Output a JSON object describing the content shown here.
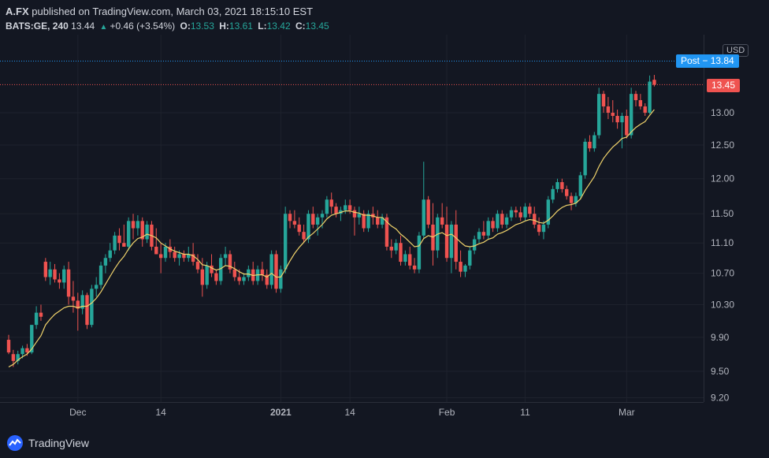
{
  "header": {
    "author": "A.FX",
    "published_text": "published on TradingView.com, March 03, 2021 18:15:10 EST"
  },
  "legend": {
    "symbol": "BATS:GE, 240",
    "last": "13.44",
    "change": "+0.46 (+3.54%)",
    "o_label": "O:",
    "o": "13.53",
    "h_label": "H:",
    "h": "13.61",
    "l_label": "L:",
    "l": "13.42",
    "c_label": "C:",
    "c": "13.45"
  },
  "price_axis": {
    "currency": "USD"
  },
  "tags": {
    "post": "Post − 13.84",
    "last": "13.45"
  },
  "footer": {
    "brand": "TradingView"
  },
  "colors": {
    "up": "#26a69a",
    "down": "#ef5350",
    "ma": "#f0d36b",
    "post_line": "#2196f3",
    "last_line": "#ef5350",
    "background": "#131722"
  },
  "chart_data": {
    "type": "candlestick",
    "symbol": "BATS:GE",
    "interval": "240",
    "y_axis": {
      "scale": "log",
      "ticks": [
        9.2,
        9.5,
        9.9,
        10.3,
        10.7,
        11.1,
        11.5,
        12.0,
        12.5,
        13.0
      ],
      "tick_labels": [
        "9.20",
        "9.50",
        "9.90",
        "10.30",
        "10.70",
        "11.10",
        "11.50",
        "12.00",
        "12.50",
        "13.00"
      ]
    },
    "x_axis": {
      "labels": [
        "Dec",
        "14",
        "2021",
        "14",
        "Feb",
        "11",
        "Mar"
      ],
      "label_candle_index": [
        15,
        33,
        59,
        74,
        95,
        112,
        134
      ]
    },
    "horizontal_lines": [
      {
        "name": "Post",
        "value": 13.84
      },
      {
        "name": "Last",
        "value": 13.45
      }
    ],
    "candles_ohlc": [
      [
        9.87,
        9.93,
        9.7,
        9.72
      ],
      [
        9.7,
        9.75,
        9.55,
        9.62
      ],
      [
        9.62,
        9.74,
        9.58,
        9.7
      ],
      [
        9.7,
        9.8,
        9.65,
        9.77
      ],
      [
        9.77,
        9.82,
        9.68,
        9.72
      ],
      [
        9.72,
        10.05,
        9.7,
        10.05
      ],
      [
        10.05,
        10.28,
        10.0,
        10.2
      ],
      [
        10.2,
        10.3,
        10.1,
        10.15
      ],
      [
        10.85,
        10.9,
        10.6,
        10.65
      ],
      [
        10.65,
        10.85,
        10.55,
        10.75
      ],
      [
        10.75,
        10.82,
        10.58,
        10.62
      ],
      [
        10.62,
        10.7,
        10.5,
        10.58
      ],
      [
        10.58,
        10.8,
        10.5,
        10.75
      ],
      [
        10.75,
        10.85,
        10.3,
        10.4
      ],
      [
        10.4,
        10.6,
        10.2,
        10.35
      ],
      [
        10.35,
        10.45,
        9.98,
        10.25
      ],
      [
        10.25,
        10.48,
        10.18,
        10.42
      ],
      [
        10.42,
        10.45,
        10.0,
        10.05
      ],
      [
        10.05,
        10.55,
        10.02,
        10.5
      ],
      [
        10.5,
        10.65,
        10.4,
        10.55
      ],
      [
        10.55,
        10.85,
        10.5,
        10.8
      ],
      [
        10.8,
        10.95,
        10.7,
        10.9
      ],
      [
        10.9,
        11.1,
        10.85,
        11.0
      ],
      [
        11.0,
        11.25,
        10.95,
        11.2
      ],
      [
        11.2,
        11.3,
        11.0,
        11.1
      ],
      [
        11.1,
        11.35,
        11.05,
        11.05
      ],
      [
        11.05,
        11.45,
        11.0,
        11.4
      ],
      [
        11.4,
        11.5,
        11.15,
        11.3
      ],
      [
        11.3,
        11.48,
        11.2,
        11.4
      ],
      [
        11.4,
        11.45,
        11.05,
        11.15
      ],
      [
        11.15,
        11.4,
        11.1,
        11.35
      ],
      [
        11.35,
        11.4,
        11.0,
        11.05
      ],
      [
        11.05,
        11.3,
        10.95,
        10.95
      ],
      [
        10.95,
        11.1,
        10.7,
        10.9
      ],
      [
        10.9,
        11.1,
        10.85,
        11.05
      ],
      [
        11.05,
        11.15,
        10.9,
        10.98
      ],
      [
        10.98,
        11.05,
        10.85,
        10.9
      ],
      [
        10.9,
        11.0,
        10.8,
        10.95
      ],
      [
        10.95,
        11.0,
        10.85,
        10.9
      ],
      [
        10.9,
        11.05,
        10.85,
        10.95
      ],
      [
        10.95,
        11.1,
        10.8,
        10.85
      ],
      [
        10.85,
        10.95,
        10.7,
        10.75
      ],
      [
        10.75,
        10.9,
        10.4,
        10.55
      ],
      [
        10.55,
        10.85,
        10.5,
        10.8
      ],
      [
        10.8,
        10.95,
        10.65,
        10.7
      ],
      [
        10.7,
        10.75,
        10.55,
        10.6
      ],
      [
        10.6,
        10.95,
        10.55,
        10.9
      ],
      [
        10.9,
        11.05,
        10.8,
        10.95
      ],
      [
        10.95,
        11.0,
        10.7,
        10.75
      ],
      [
        10.75,
        10.85,
        10.6,
        10.65
      ],
      [
        10.65,
        10.75,
        10.55,
        10.6
      ],
      [
        10.6,
        10.7,
        10.55,
        10.65
      ],
      [
        10.65,
        10.8,
        10.6,
        10.75
      ],
      [
        10.75,
        10.85,
        10.55,
        10.6
      ],
      [
        10.6,
        10.8,
        10.55,
        10.75
      ],
      [
        10.75,
        10.85,
        10.6,
        10.68
      ],
      [
        10.68,
        10.75,
        10.5,
        10.55
      ],
      [
        10.55,
        11.0,
        10.5,
        10.95
      ],
      [
        10.95,
        11.0,
        10.45,
        10.5
      ],
      [
        10.5,
        10.8,
        10.45,
        10.75
      ],
      [
        10.75,
        11.6,
        10.7,
        11.5
      ],
      [
        11.5,
        11.55,
        11.3,
        11.4
      ],
      [
        11.4,
        11.55,
        11.3,
        11.35
      ],
      [
        11.35,
        11.45,
        11.2,
        11.25
      ],
      [
        11.25,
        11.35,
        11.1,
        11.15
      ],
      [
        11.15,
        11.55,
        11.1,
        11.5
      ],
      [
        11.5,
        11.6,
        11.3,
        11.35
      ],
      [
        11.35,
        11.5,
        11.2,
        11.45
      ],
      [
        11.45,
        11.55,
        11.3,
        11.5
      ],
      [
        11.5,
        11.75,
        11.45,
        11.7
      ],
      [
        11.7,
        11.8,
        11.5,
        11.6
      ],
      [
        11.6,
        11.65,
        11.45,
        11.5
      ],
      [
        11.5,
        11.6,
        11.4,
        11.55
      ],
      [
        11.55,
        11.7,
        11.5,
        11.62
      ],
      [
        11.62,
        11.7,
        11.5,
        11.55
      ],
      [
        11.55,
        11.6,
        11.2,
        11.45
      ],
      [
        11.45,
        11.6,
        11.35,
        11.5
      ],
      [
        11.5,
        11.55,
        11.25,
        11.3
      ],
      [
        11.3,
        11.55,
        11.25,
        11.5
      ],
      [
        11.5,
        11.6,
        11.35,
        11.45
      ],
      [
        11.45,
        11.55,
        11.3,
        11.35
      ],
      [
        11.35,
        11.5,
        11.3,
        11.45
      ],
      [
        11.45,
        11.5,
        11.0,
        11.05
      ],
      [
        11.05,
        11.15,
        10.9,
        11.0
      ],
      [
        11.0,
        11.15,
        10.95,
        11.1
      ],
      [
        11.1,
        11.2,
        10.8,
        10.85
      ],
      [
        10.85,
        11.0,
        10.8,
        10.95
      ],
      [
        10.95,
        11.05,
        10.75,
        10.8
      ],
      [
        10.8,
        10.9,
        10.7,
        10.75
      ],
      [
        10.75,
        11.25,
        10.7,
        11.2
      ],
      [
        11.2,
        12.25,
        11.15,
        11.7
      ],
      [
        11.7,
        11.75,
        11.3,
        11.35
      ],
      [
        11.35,
        11.65,
        10.8,
        11.0
      ],
      [
        11.0,
        11.5,
        10.9,
        11.45
      ],
      [
        11.45,
        11.65,
        11.3,
        11.35
      ],
      [
        11.35,
        11.6,
        10.85,
        10.9
      ],
      [
        10.9,
        11.4,
        10.7,
        11.35
      ],
      [
        11.35,
        11.55,
        10.75,
        10.85
      ],
      [
        10.85,
        11.0,
        10.65,
        10.72
      ],
      [
        10.72,
        10.82,
        10.65,
        10.8
      ],
      [
        10.8,
        11.05,
        10.75,
        11.0
      ],
      [
        11.0,
        11.2,
        10.95,
        11.15
      ],
      [
        11.15,
        11.3,
        11.1,
        11.25
      ],
      [
        11.25,
        11.4,
        11.15,
        11.2
      ],
      [
        11.2,
        11.45,
        11.15,
        11.4
      ],
      [
        11.4,
        11.45,
        11.25,
        11.3
      ],
      [
        11.3,
        11.55,
        11.25,
        11.5
      ],
      [
        11.5,
        11.55,
        11.3,
        11.35
      ],
      [
        11.35,
        11.5,
        11.3,
        11.45
      ],
      [
        11.45,
        11.6,
        11.4,
        11.55
      ],
      [
        11.55,
        11.6,
        11.45,
        11.52
      ],
      [
        11.52,
        11.6,
        11.4,
        11.45
      ],
      [
        11.45,
        11.65,
        11.4,
        11.6
      ],
      [
        11.6,
        11.65,
        11.45,
        11.5
      ],
      [
        11.5,
        11.6,
        11.3,
        11.35
      ],
      [
        11.35,
        11.45,
        11.2,
        11.25
      ],
      [
        11.25,
        11.4,
        11.15,
        11.35
      ],
      [
        11.35,
        11.75,
        11.3,
        11.7
      ],
      [
        11.7,
        11.9,
        11.65,
        11.85
      ],
      [
        11.85,
        12.0,
        11.8,
        11.95
      ],
      [
        11.95,
        12.0,
        11.8,
        11.85
      ],
      [
        11.85,
        11.9,
        11.7,
        11.75
      ],
      [
        11.75,
        11.8,
        11.55,
        11.65
      ],
      [
        11.65,
        11.8,
        11.6,
        11.75
      ],
      [
        11.75,
        12.1,
        11.7,
        12.05
      ],
      [
        12.05,
        12.6,
        12.0,
        12.55
      ],
      [
        12.55,
        12.65,
        12.4,
        12.45
      ],
      [
        12.45,
        12.7,
        12.4,
        12.65
      ],
      [
        12.65,
        13.4,
        12.6,
        13.3
      ],
      [
        13.3,
        13.35,
        13.0,
        13.1
      ],
      [
        13.1,
        13.25,
        12.9,
        13.0
      ],
      [
        13.0,
        13.2,
        12.85,
        12.95
      ],
      [
        12.95,
        13.05,
        12.75,
        12.85
      ],
      [
        12.85,
        13.0,
        12.45,
        12.95
      ],
      [
        12.95,
        13.05,
        12.6,
        12.65
      ],
      [
        12.65,
        13.4,
        12.6,
        13.3
      ],
      [
        13.3,
        13.35,
        13.1,
        13.2
      ],
      [
        13.2,
        13.3,
        13.05,
        13.1
      ],
      [
        13.1,
        13.15,
        12.95,
        13.0
      ],
      [
        13.0,
        13.6,
        12.98,
        13.5
      ],
      [
        13.53,
        13.61,
        13.42,
        13.45
      ]
    ],
    "moving_average": [
      9.55,
      9.58,
      9.63,
      9.67,
      9.7,
      9.76,
      9.84,
      9.92,
      10.05,
      10.12,
      10.18,
      10.22,
      10.26,
      10.28,
      10.28,
      10.26,
      10.28,
      10.28,
      10.32,
      10.38,
      10.46,
      10.56,
      10.66,
      10.76,
      10.85,
      10.92,
      11.02,
      11.1,
      11.16,
      11.18,
      11.22,
      11.2,
      11.17,
      11.1,
      11.06,
      11.02,
      10.99,
      10.97,
      10.95,
      10.95,
      10.93,
      10.88,
      10.81,
      10.8,
      10.77,
      10.74,
      10.76,
      10.8,
      10.79,
      10.76,
      10.72,
      10.69,
      10.69,
      10.67,
      10.68,
      10.68,
      10.65,
      10.7,
      10.65,
      10.65,
      10.75,
      10.86,
      10.96,
      11.04,
      11.11,
      11.18,
      11.23,
      11.29,
      11.35,
      11.43,
      11.48,
      11.5,
      11.52,
      11.54,
      11.54,
      11.52,
      11.51,
      11.48,
      11.48,
      11.47,
      11.45,
      11.45,
      11.39,
      11.33,
      11.29,
      11.22,
      11.17,
      11.11,
      11.05,
      11.06,
      11.16,
      11.2,
      11.18,
      11.22,
      11.24,
      11.2,
      11.22,
      11.17,
      11.11,
      11.06,
      11.05,
      11.06,
      11.09,
      11.11,
      11.15,
      11.17,
      11.22,
      11.24,
      11.27,
      11.31,
      11.35,
      11.37,
      11.4,
      11.42,
      11.41,
      11.38,
      11.37,
      11.41,
      11.47,
      11.54,
      11.59,
      11.62,
      11.63,
      11.65,
      11.71,
      11.83,
      11.93,
      12.03,
      12.18,
      12.3,
      12.39,
      12.47,
      12.53,
      12.6,
      12.62,
      12.7,
      12.77,
      12.82,
      12.86,
      12.96,
      13.05
    ]
  }
}
